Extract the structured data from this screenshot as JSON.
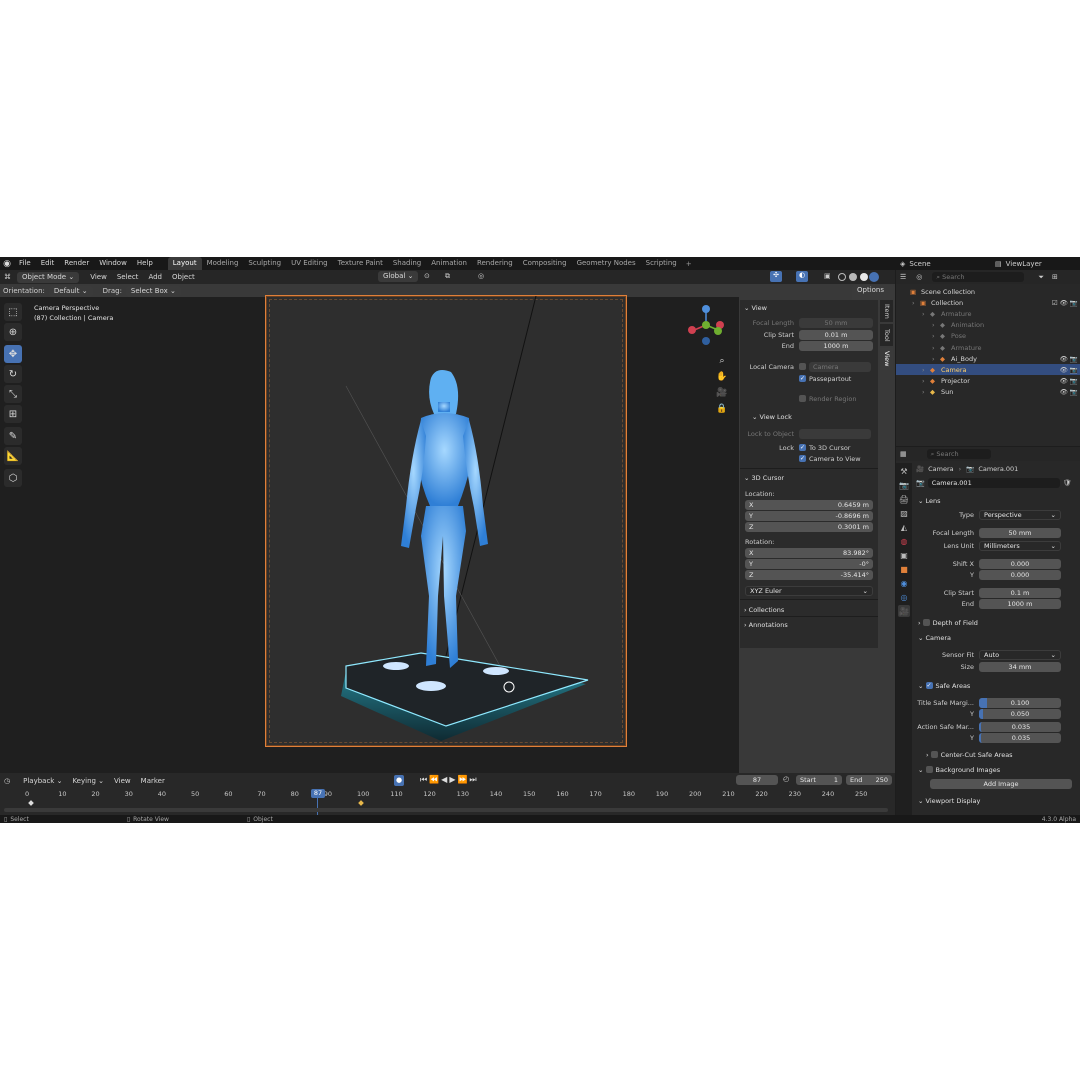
{
  "menu": {
    "file": "File",
    "edit": "Edit",
    "render": "Render",
    "window": "Window",
    "help": "Help"
  },
  "workspaces": [
    "Layout",
    "Modeling",
    "Sculpting",
    "UV Editing",
    "Texture Paint",
    "Shading",
    "Animation",
    "Rendering",
    "Compositing",
    "Geometry Nodes",
    "Scripting"
  ],
  "scene": {
    "name": "Scene",
    "view_layer": "ViewLayer"
  },
  "viewport": {
    "mode": "Object Mode",
    "view": "View",
    "select": "Select",
    "add": "Add",
    "object": "Object",
    "transform": "Global",
    "orientation_label": "Orientation:",
    "orientation": "Default",
    "drag_label": "Drag:",
    "drag": "Select Box",
    "options": "Options",
    "overlay_title": "Camera Perspective",
    "overlay_sub": "(87) Collection | Camera",
    "side_tabs": [
      "Item",
      "Tool",
      "View"
    ]
  },
  "npanel": {
    "view_title": "View",
    "focal_length_label": "Focal Length",
    "focal_length": "50 mm",
    "clip_start_label": "Clip Start",
    "clip_start": "0.01 m",
    "end_label": "End",
    "end": "1000 m",
    "local_camera_label": "Local Camera",
    "local_camera": "Camera",
    "passepartout": "Passepartout",
    "render_region": "Render Region",
    "view_lock_title": "View Lock",
    "lock_to_object_label": "Lock to Object",
    "lock_label": "Lock",
    "to_3d_cursor": "To 3D Cursor",
    "camera_to_view": "Camera to View",
    "cursor_title": "3D Cursor",
    "location_label": "Location:",
    "loc": [
      {
        "axis": "X",
        "value": "0.6459 m"
      },
      {
        "axis": "Y",
        "value": "-0.8696 m"
      },
      {
        "axis": "Z",
        "value": "0.3001 m"
      }
    ],
    "rotation_label": "Rotation:",
    "rot": [
      {
        "axis": "X",
        "value": "83.982°"
      },
      {
        "axis": "Y",
        "value": "-0°"
      },
      {
        "axis": "Z",
        "value": "-35.414°"
      }
    ],
    "rotation_mode": "XYZ Euler",
    "collections": "Collections",
    "annotations": "Annotations"
  },
  "outliner": {
    "search_placeholder": "Search",
    "items": [
      {
        "label": "Scene Collection",
        "indent": 0
      },
      {
        "label": "Collection",
        "indent": 1
      },
      {
        "label": "Armature",
        "indent": 2,
        "dim": true
      },
      {
        "label": "Animation",
        "indent": 3,
        "dim": true
      },
      {
        "label": "Pose",
        "indent": 3,
        "dim": true
      },
      {
        "label": "Armature",
        "indent": 3,
        "dim": true
      },
      {
        "label": "Ai_Body",
        "indent": 3
      },
      {
        "label": "Camera",
        "indent": 2,
        "selected": true
      },
      {
        "label": "Projector",
        "indent": 2
      },
      {
        "label": "Sun",
        "indent": 2
      }
    ]
  },
  "properties": {
    "search_placeholder": "Search",
    "breadcrumb_object": "Camera",
    "breadcrumb_data": "Camera.001",
    "data_name": "Camera.001",
    "lens_title": "Lens",
    "type_label": "Type",
    "type": "Perspective",
    "focal_length_label": "Focal Length",
    "focal_length": "50 mm",
    "lens_unit_label": "Lens Unit",
    "lens_unit": "Millimeters",
    "shift_x_label": "Shift X",
    "shift_x": "0.000",
    "y_label": "Y",
    "shift_y": "0.000",
    "clip_start_label": "Clip Start",
    "clip_start": "0.1 m",
    "end_label": "End",
    "clip_end": "1000 m",
    "dof_title": "Depth of Field",
    "camera_title": "Camera",
    "sensor_fit_label": "Sensor Fit",
    "sensor_fit": "Auto",
    "size_label": "Size",
    "size": "34 mm",
    "safe_areas_title": "Safe Areas",
    "title_safe_label": "Title Safe Margi...",
    "title_safe_x": "0.100",
    "title_safe_y": "0.050",
    "title_safe_x_fill": 0.1,
    "title_safe_y_fill": 0.05,
    "action_safe_label": "Action Safe Mar...",
    "action_safe_x": "0.035",
    "action_safe_y": "0.035",
    "center_cut": "Center-Cut Safe Areas",
    "background_images": "Background Images",
    "add_image": "Add Image",
    "viewport_display": "Viewport Display"
  },
  "timeline": {
    "playback": "Playback",
    "keying": "Keying",
    "view": "View",
    "marker": "Marker",
    "current_frame": "87",
    "start_label": "Start",
    "start": "1",
    "end_label": "End",
    "end": "250",
    "ticks": [
      "0",
      "10",
      "20",
      "30",
      "40",
      "50",
      "60",
      "70",
      "80",
      "90",
      "100",
      "110",
      "120",
      "130",
      "140",
      "150",
      "160",
      "170",
      "180",
      "190",
      "200",
      "210",
      "220",
      "230",
      "240",
      "250"
    ]
  },
  "statusbar": {
    "select": "Select",
    "rotate": "Rotate View",
    "object": "Object",
    "version": "4.3.0 Alpha"
  },
  "colors": {
    "accent": "#4772b3",
    "camera_frame": "#e0803a",
    "hologram": "#4aa8f0"
  }
}
